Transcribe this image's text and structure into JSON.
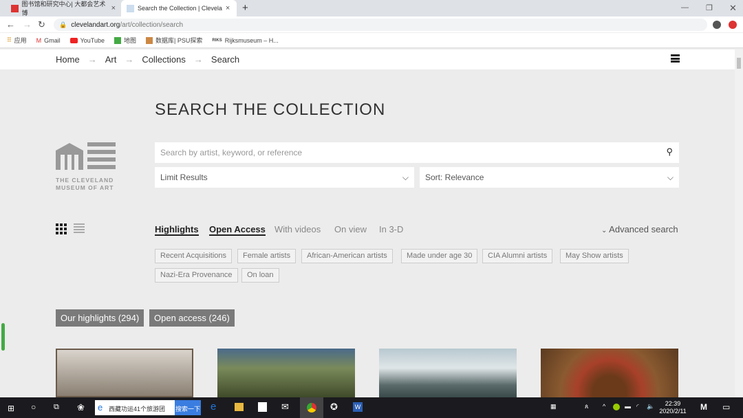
{
  "browser": {
    "tabs": [
      {
        "title": "图书馆和研究中心| 大都会艺术博"
      },
      {
        "title": "Search the Collection | Clevela"
      }
    ],
    "url_domain": "clevelandart.org",
    "url_path": "/art/collection/search",
    "bookmarks": [
      "应用",
      "Gmail",
      "YouTube",
      "地图",
      "数据库| PSU探索",
      "Rijksmuseum – H..."
    ]
  },
  "breadcrumb": [
    "Home",
    "Art",
    "Collections",
    "Search"
  ],
  "logo": {
    "line1": "THE CLEVELAND",
    "line2": "MUSEUM OF ART"
  },
  "page_title": "SEARCH THE COLLECTION",
  "search": {
    "placeholder": "Search by artist, keyword, or reference"
  },
  "limit_results": "Limit Results",
  "sort": "Sort: Relevance",
  "filters": [
    {
      "label": "Highlights",
      "active": true
    },
    {
      "label": "Open Access",
      "active": true
    },
    {
      "label": "With videos"
    },
    {
      "label": "On view"
    },
    {
      "label": "In 3-D"
    }
  ],
  "advanced_search": "Advanced search",
  "chips": [
    "Recent Acquisitions",
    "Female artists",
    "African-American artists",
    "Made under age 30",
    "CIA Alumni artists",
    "May Show artists",
    "Nazi-Era Provenance",
    "On loan"
  ],
  "result_buttons": [
    "Our highlights (294)",
    "Open access (246)"
  ],
  "taskbar": {
    "search_text": "西藏功运41个旅游团",
    "search_button": "搜索一下",
    "time": "22:39",
    "date": "2020/2/11"
  }
}
